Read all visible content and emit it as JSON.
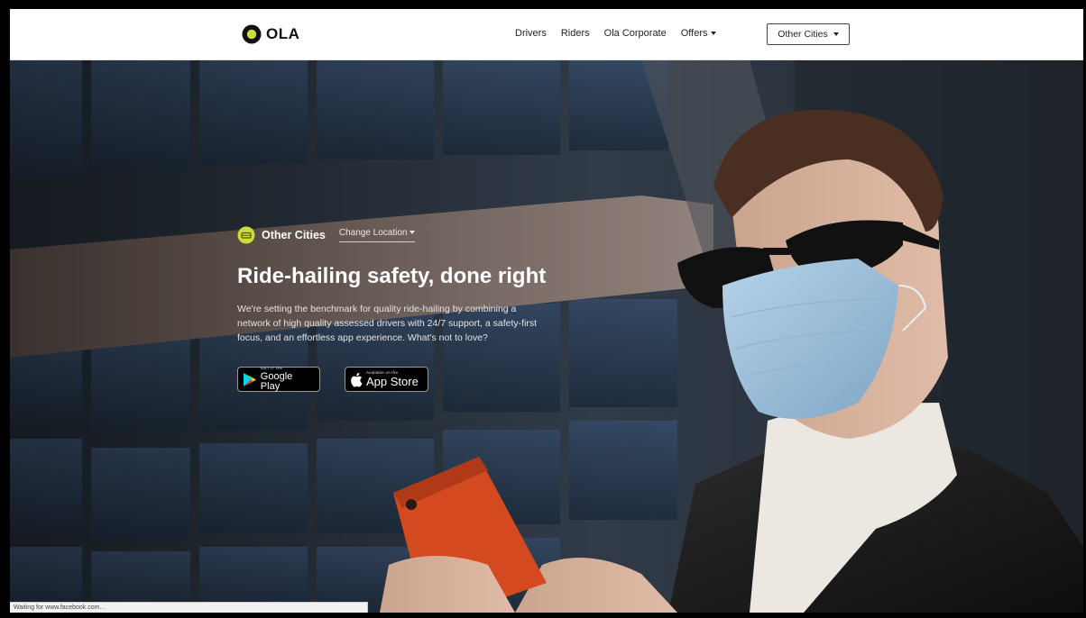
{
  "header": {
    "logo_text": "OLA",
    "nav": {
      "drivers": "Drivers",
      "riders": "Riders",
      "corporate": "Ola Corporate",
      "offers": "Offers"
    },
    "city_select": "Other Cities"
  },
  "hero": {
    "city": "Other Cities",
    "change_location": "Change Location",
    "title": "Ride-hailing safety, done right",
    "description": "We're setting the benchmark for quality ride-hailing by combining a network of high quality assessed drivers with 24/7 support, a safety-first focus, and an effortless app experience. What's not to love?",
    "google_play": {
      "small": "GET IT ON",
      "big": "Google Play"
    },
    "app_store": {
      "small": "Available on the",
      "big": "App Store"
    }
  },
  "status_bar": "Waiting for www.facebook.com...",
  "colors": {
    "brand_accent": "#cddc39",
    "nav_bg": "#ffffff",
    "hero_text": "#ffffff"
  }
}
